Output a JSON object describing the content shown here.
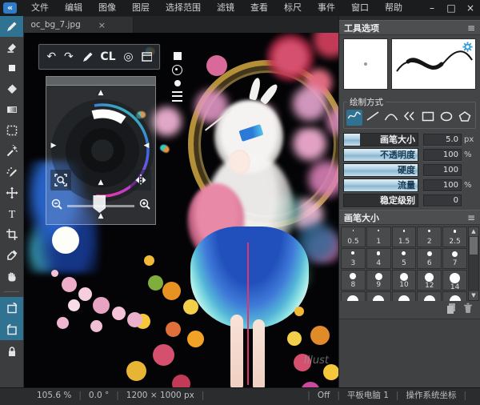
{
  "window": {
    "minimize": "–",
    "maximize": "□",
    "close": "×",
    "app_icon_glyph": "«"
  },
  "menu": {
    "items": [
      "文件",
      "编辑",
      "图像",
      "图层",
      "选择范围",
      "滤镜",
      "查看",
      "标尺",
      "事件",
      "窗口",
      "帮助"
    ]
  },
  "tab": {
    "title": "oc_bg_7.jpg",
    "close_glyph": "×"
  },
  "toolbar_left": {
    "items": [
      {
        "name": "pen",
        "selected": true
      },
      {
        "name": "eraser"
      },
      {
        "name": "shape-brush"
      },
      {
        "name": "bucket-fill"
      },
      {
        "name": "gradient"
      },
      {
        "name": "rect-select"
      },
      {
        "name": "magic-wand"
      },
      {
        "name": "select-pen"
      },
      {
        "name": "move"
      },
      {
        "name": "text"
      },
      {
        "name": "crop"
      },
      {
        "name": "eyedropper"
      },
      {
        "name": "hand"
      },
      {
        "name": "divider"
      },
      {
        "name": "view-rotate-left",
        "selected": true
      },
      {
        "name": "view-rotate-right",
        "selected": true
      },
      {
        "name": "lock"
      }
    ]
  },
  "floating_toolbar": {
    "undo_glyph": "↶",
    "redo_glyph": "↷",
    "cl_label": "CL",
    "target_glyph": "◎"
  },
  "canvas": {
    "watermark": "Illust"
  },
  "panels": {
    "tool_options": {
      "title": "工具选项",
      "menu_glyph": "≡"
    },
    "draw_mode": {
      "title": "绘制方式",
      "modes": [
        {
          "name": "freehand",
          "selected": true
        },
        {
          "name": "line"
        },
        {
          "name": "curve"
        },
        {
          "name": "polyline"
        },
        {
          "name": "rect"
        },
        {
          "name": "ellipse"
        },
        {
          "name": "polygon"
        }
      ]
    },
    "sliders": [
      {
        "label": "画笔大小",
        "value": "5.0",
        "unit": "px",
        "fill_pct": 22
      },
      {
        "label": "不透明度",
        "value": "100",
        "unit": "%",
        "fill_pct": 100
      },
      {
        "label": "硬度",
        "value": "100",
        "unit": "",
        "fill_pct": 100
      },
      {
        "label": "流量",
        "value": "100",
        "unit": "%",
        "fill_pct": 100
      },
      {
        "label": "稳定级别",
        "value": "0",
        "unit": "",
        "fill_pct": 0
      }
    ],
    "brush_size": {
      "title": "画笔大小",
      "menu_glyph": "≡",
      "sizes": [
        "0.5",
        "1",
        "1.5",
        "2",
        "2.5",
        "3",
        "4",
        "5",
        "6",
        "7",
        "8",
        "9",
        "10",
        "12",
        "14"
      ],
      "partial_row_cells": 5,
      "scroll_up_glyph": "▲",
      "scroll_down_glyph": "▼"
    }
  },
  "status_bar": {
    "left_items": [
      "105.6 %",
      "0.0 °",
      "1200 × 1000 px"
    ],
    "right_items": [
      "Off",
      "平板电脑 1",
      "操作系统坐标"
    ],
    "separator": "|"
  },
  "colors": {
    "accent_selected": "#2f7292",
    "gear_blue": "#3a9ad8",
    "slider_fill": "#a8cbdf",
    "app_icon_blue": "#2e7cc8",
    "ribbon_pink": "#e0366e"
  }
}
